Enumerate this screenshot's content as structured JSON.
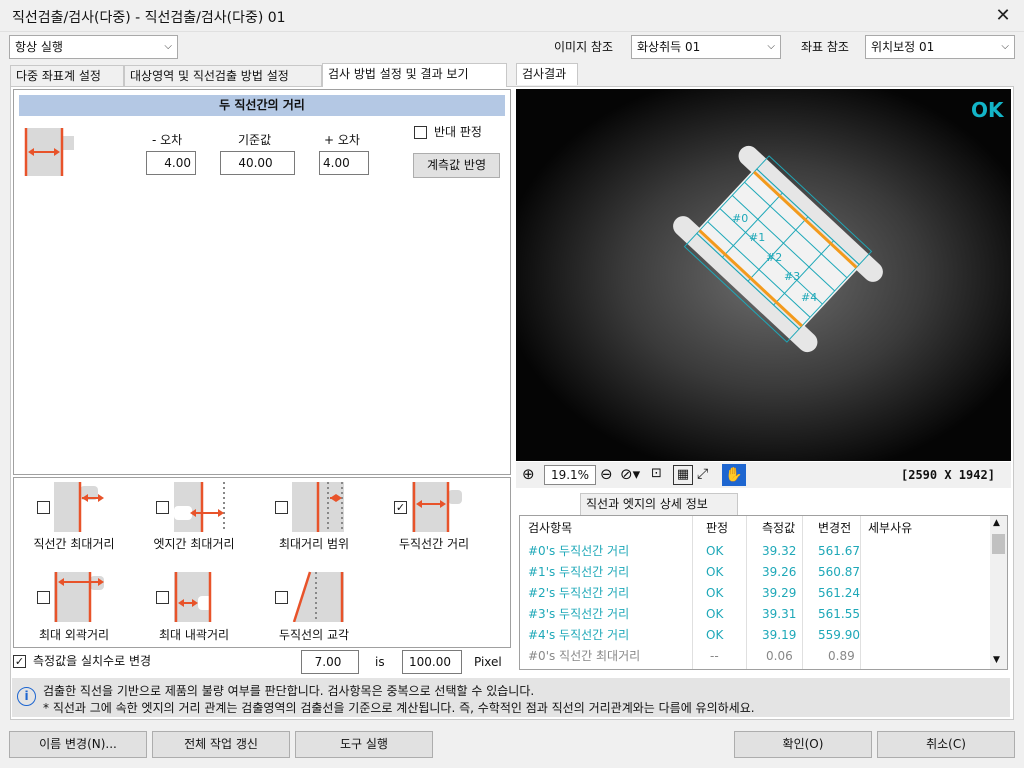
{
  "window": {
    "title": "직선검출/검사(다중) - 직선검출/검사(다중) 01",
    "close_glyph": "✕"
  },
  "toolbar": {
    "run_mode": "항상 실행",
    "image_ref_label": "이미지 참조",
    "image_ref_value": "화상취득 01",
    "coord_ref_label": "좌표 참조",
    "coord_ref_value": "위치보정 01"
  },
  "tabs": [
    {
      "label": "다중 좌표계 설정"
    },
    {
      "label": "대상영역 및 직선검출 방법 설정"
    },
    {
      "label": "검사 방법 설정 및 결과 보기"
    }
  ],
  "method": {
    "header": "두 직선간의 거리",
    "minus_label": "- 오차",
    "ref_label": "기준값",
    "plus_label": "+ 오차",
    "minus_value": "4.00",
    "ref_value": "40.00",
    "plus_value": "4.00",
    "reverse_label": "반대 판정",
    "apply_button": "계측값 반영"
  },
  "types": [
    {
      "label": "직선간 최대거리",
      "checked": false
    },
    {
      "label": "엣지간 최대거리",
      "checked": false
    },
    {
      "label": "최대거리 범위",
      "checked": false
    },
    {
      "label": "두직선간 거리",
      "checked": true
    },
    {
      "label": "최대 외곽거리",
      "checked": false
    },
    {
      "label": "최대 내곽거리",
      "checked": false
    },
    {
      "label": "두직선의 교각",
      "checked": false
    }
  ],
  "convert": {
    "label": "측정값을 실치수로 변경",
    "value1": "7.00",
    "is_label": "is",
    "value2": "100.00",
    "unit": "Pixel"
  },
  "image": {
    "status": "OK",
    "labels": [
      "#0",
      "#1",
      "#2",
      "#3",
      "#4"
    ],
    "zoom": "19.1%",
    "size": "[2590 X 1942]"
  },
  "result_tabs": [
    {
      "label": "검사결과"
    },
    {
      "label": "직선과 엣지의 상세 정보"
    }
  ],
  "results": {
    "headers": [
      "검사항목",
      "판정",
      "측정값",
      "변경전",
      "세부사유"
    ],
    "rows": [
      [
        "#0's 두직선간 거리",
        "OK",
        "39.32",
        "561.67",
        ""
      ],
      [
        "#1's 두직선간 거리",
        "OK",
        "39.26",
        "560.87",
        ""
      ],
      [
        "#2's 두직선간 거리",
        "OK",
        "39.29",
        "561.24",
        ""
      ],
      [
        "#3's 두직선간 거리",
        "OK",
        "39.31",
        "561.55",
        ""
      ],
      [
        "#4's 두직선간 거리",
        "OK",
        "39.19",
        "559.90",
        ""
      ],
      [
        "#0's 직선간 최대거리",
        "--",
        "0.06",
        "0.89",
        ""
      ]
    ]
  },
  "info": {
    "line1": "검출한 직선을 기반으로 제품의 불량 여부를 판단합니다. 검사항목은 중복으로 선택할 수 있습니다.",
    "line2": "* 직선과 그에 속한 엣지의 거리 관계는 검출영역의 검출선을 기준으로 계산됩니다. 즉, 수학적인 점과 직선의 거리관계와는 다름에 유의하세요."
  },
  "footer": {
    "rename": "이름 변경(N)...",
    "refresh": "전체 작업 갱신",
    "run_tool": "도구 실행",
    "ok": "확인(O)",
    "cancel": "취소(C)"
  },
  "colors": {
    "accent_red": "#e8532a",
    "teal": "#1ea8b8",
    "header_blue": "#b4c8e4",
    "ok_green": "#13b5c8"
  }
}
